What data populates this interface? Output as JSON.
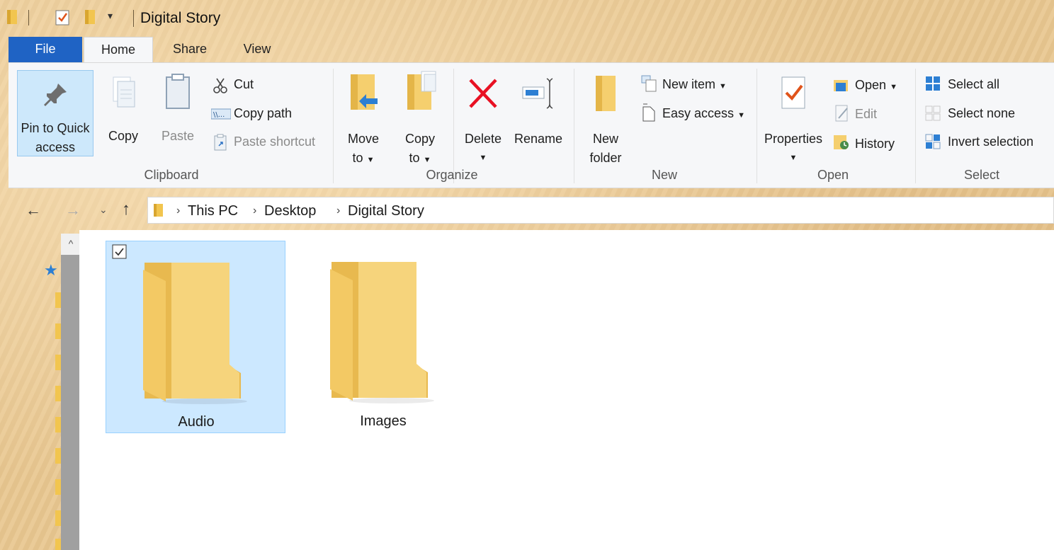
{
  "window": {
    "title": "Digital Story"
  },
  "tabs": {
    "file": "File",
    "home": "Home",
    "share": "Share",
    "view": "View"
  },
  "ribbon": {
    "clipboard": {
      "label": "Clipboard",
      "pin_line1": "Pin to Quick",
      "pin_line2": "access",
      "copy": "Copy",
      "paste": "Paste",
      "cut": "Cut",
      "copy_path": "Copy path",
      "paste_shortcut": "Paste shortcut"
    },
    "organize": {
      "label": "Organize",
      "move_line1": "Move",
      "move_line2": "to",
      "copy_line1": "Copy",
      "copy_line2": "to",
      "delete": "Delete",
      "rename": "Rename"
    },
    "new": {
      "label": "New",
      "folder_line1": "New",
      "folder_line2": "folder",
      "new_item": "New item",
      "easy_access": "Easy access"
    },
    "open": {
      "label": "Open",
      "properties": "Properties",
      "open": "Open",
      "edit": "Edit",
      "history": "History"
    },
    "select": {
      "label": "Select",
      "select_all": "Select all",
      "select_none": "Select none",
      "invert_selection": "Invert selection"
    }
  },
  "address": {
    "crumbs": [
      "This PC",
      "Desktop",
      "Digital Story"
    ]
  },
  "folders": [
    {
      "name": "Audio",
      "selected": true
    },
    {
      "name": "Images",
      "selected": false
    }
  ],
  "colors": {
    "accent": "#1f63c4",
    "selection": "#cce8ff",
    "folder": "#f5cf6e",
    "delete_red": "#e81123"
  }
}
